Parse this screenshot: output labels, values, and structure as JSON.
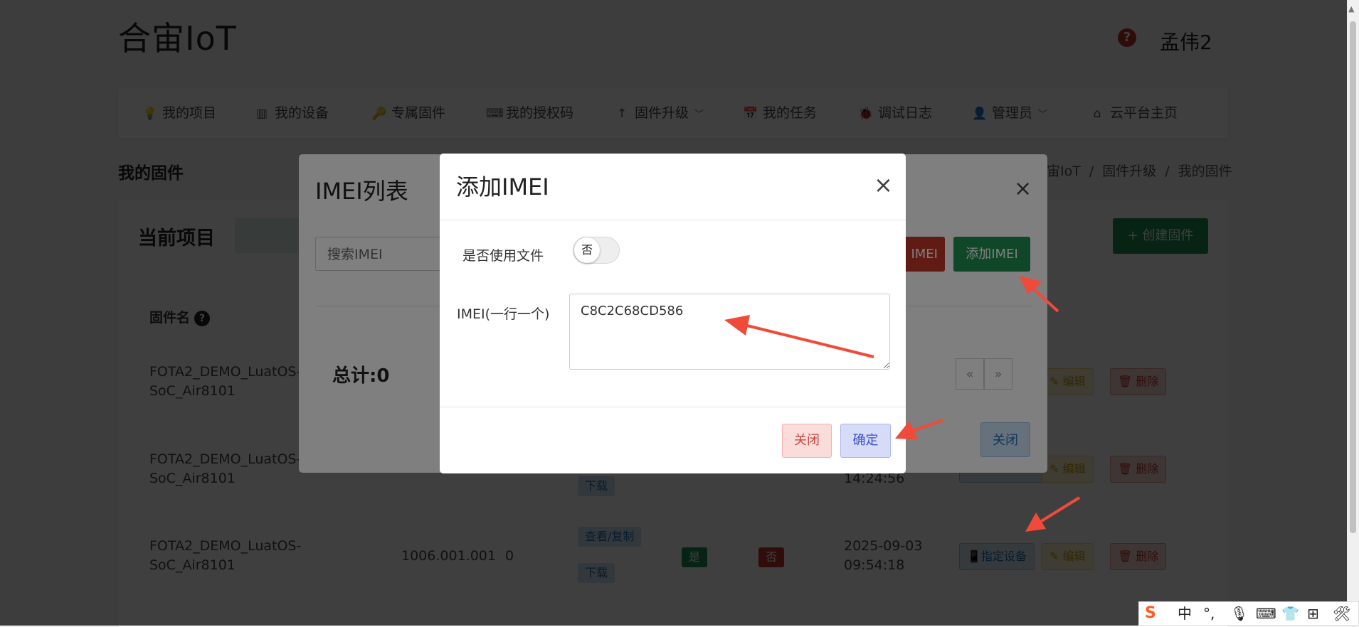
{
  "header": {
    "logo": "合宙IoT",
    "help_icon": "?",
    "user": "孟伟2"
  },
  "nav": [
    {
      "label": "我的项目",
      "icon": "💡",
      "icon_name": "bulb-icon"
    },
    {
      "label": "我的设备",
      "icon": "▥",
      "icon_name": "chip-icon"
    },
    {
      "label": "专属固件",
      "icon": "🔑",
      "icon_name": "key-icon"
    },
    {
      "label": "我的授权码",
      "icon": "⌨",
      "icon_name": "keyboard-icon"
    },
    {
      "label": "固件升级",
      "icon": "↑",
      "icon_name": "arrow-up-icon",
      "chevron": "﹀"
    },
    {
      "label": "我的任务",
      "icon": "📅",
      "icon_name": "calendar-icon"
    },
    {
      "label": "调试日志",
      "icon": "🐞",
      "icon_name": "bug-icon"
    },
    {
      "label": "管理员",
      "icon": "👤",
      "icon_name": "user-icon",
      "chevron": "﹀"
    },
    {
      "label": "云平台主页",
      "icon": "⌂",
      "icon_name": "home-icon"
    }
  ],
  "page": {
    "title": "我的固件",
    "breadcrumb": [
      "宙IoT",
      "/",
      "固件升级",
      "/",
      "我的固件"
    ]
  },
  "card": {
    "title": "当前项目",
    "create_button": "+ 创建固件",
    "column_firmware_name": "固件名",
    "rows": [
      {
        "name_line1": "FOTA2_DEMO_LuatOS-",
        "name_line2": "SoC_Air8101"
      },
      {
        "name_line1": "FOTA2_DEMO_LuatOS-",
        "name_line2": "SoC_Air8101",
        "time_line2": "14:24:56",
        "download": "下载"
      },
      {
        "name_line1": "FOTA2_DEMO_LuatOS-",
        "name_line2": "SoC_Air8101",
        "version": "1006.001.001",
        "count": "0",
        "view": "查看/复制",
        "download": "下载",
        "flag1": "是",
        "flag2": "否",
        "time_line1": "2025-09-03",
        "time_line2": "09:54:18"
      }
    ],
    "actions": {
      "assign": "指定设备",
      "edit": "编辑",
      "delete": "删除"
    }
  },
  "imei_modal": {
    "title": "IMEI列表",
    "close_icon": "×",
    "search_placeholder": "搜索IMEI",
    "delete_button": "IMEI",
    "add_button": "添加IMEI",
    "total": "总计:0",
    "prev": "«",
    "next": "»",
    "close_button": "关闭"
  },
  "add_modal": {
    "title": "添加IMEI",
    "close_icon": "×",
    "use_file_label": "是否使用文件",
    "toggle_text": "否",
    "imei_label": "IMEI(一行一个)",
    "imei_value": "C8C2C68CD586",
    "close_button": "关闭",
    "ok_button": "确定"
  },
  "ime_bar": {
    "logo": "S",
    "lang": "中",
    "punct": "°,",
    "mic": "🎙",
    "keyboard": "⌨",
    "skin": "👕",
    "grid": "⊞",
    "tool": "🛠"
  },
  "colors": {
    "success": "#1e8f50",
    "danger": "#c0362b",
    "primary_light": "#cfe3f6",
    "arrow": "#f04a3a"
  }
}
